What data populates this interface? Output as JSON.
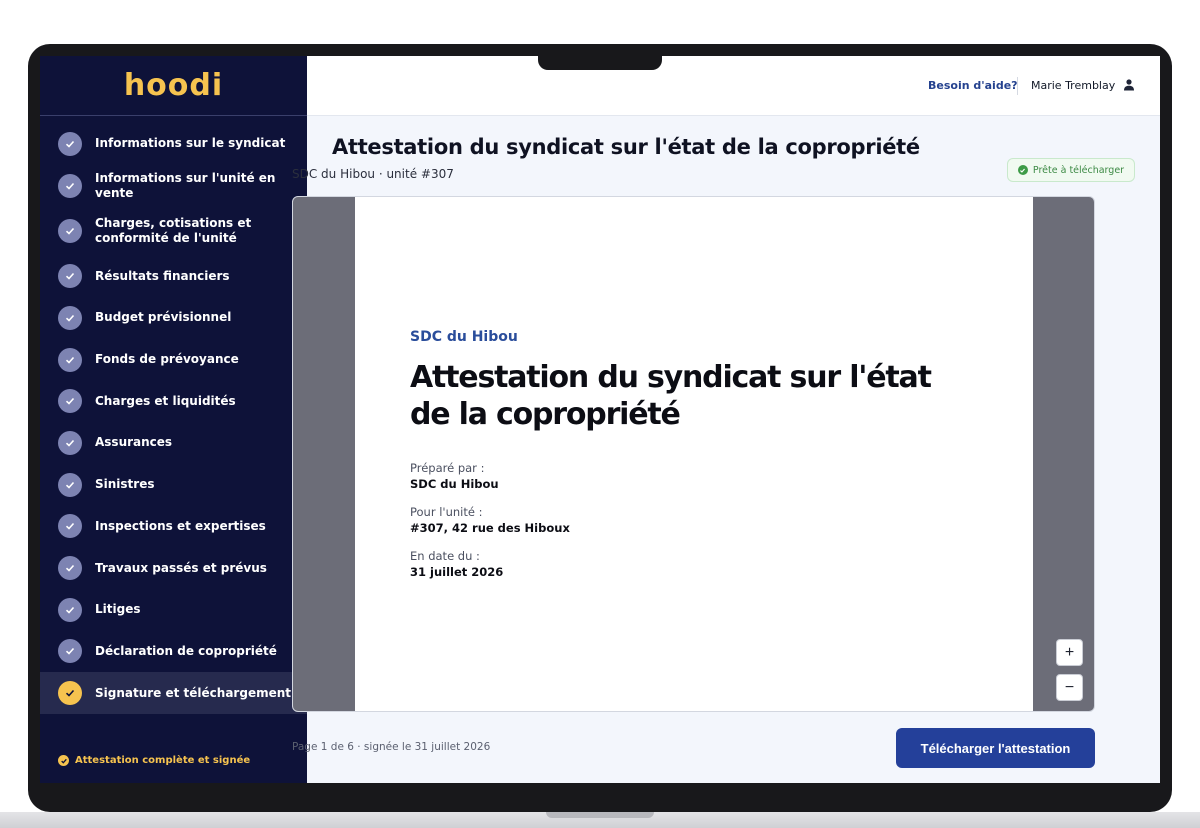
{
  "app": {
    "logo": "hoodi"
  },
  "sidebar": {
    "items": [
      {
        "label": "Informations sur le syndicat"
      },
      {
        "label": "Informations sur l'unité en vente"
      },
      {
        "label": "Charges, cotisations et conformité de l'unité"
      },
      {
        "label": "Résultats financiers"
      },
      {
        "label": "Budget prévisionnel"
      },
      {
        "label": "Fonds de prévoyance"
      },
      {
        "label": "Charges et liquidités"
      },
      {
        "label": "Assurances"
      },
      {
        "label": "Sinistres"
      },
      {
        "label": "Inspections et expertises"
      },
      {
        "label": "Travaux passés et prévus"
      },
      {
        "label": "Litiges"
      },
      {
        "label": "Déclaration de copropriété"
      },
      {
        "label": "Signature et téléchargement"
      }
    ],
    "footer": "Attestation complète et signée"
  },
  "topbar": {
    "help": "Besoin d'aide?",
    "user": "Marie Tremblay"
  },
  "main": {
    "title": "Attestation du syndicat sur l'état de la copropriété",
    "subtitle": "SDC du Hibou · unité #307",
    "status": "Prête à télécharger",
    "document": {
      "org": "SDC du Hibou",
      "title": "Attestation du syndicat sur l'état de la copropriété",
      "prepared_label": "Préparé par :",
      "prepared_value": "SDC du Hibou",
      "unit_label": "Pour l'unité :",
      "unit_value": "#307, 42 rue des Hiboux",
      "date_label": "En date du :",
      "date_value": "31 juillet 2026"
    },
    "zoom_in": "+",
    "zoom_out": "−",
    "page_info": "Page 1 de 6 · signée le 31 juillet 2026",
    "download": "Télécharger l'attestation"
  },
  "colors": {
    "sidebar_bg": "#0e1239",
    "accent_yellow": "#f6c34f",
    "primary_blue": "#24409a",
    "success_green": "#3d9b47"
  }
}
